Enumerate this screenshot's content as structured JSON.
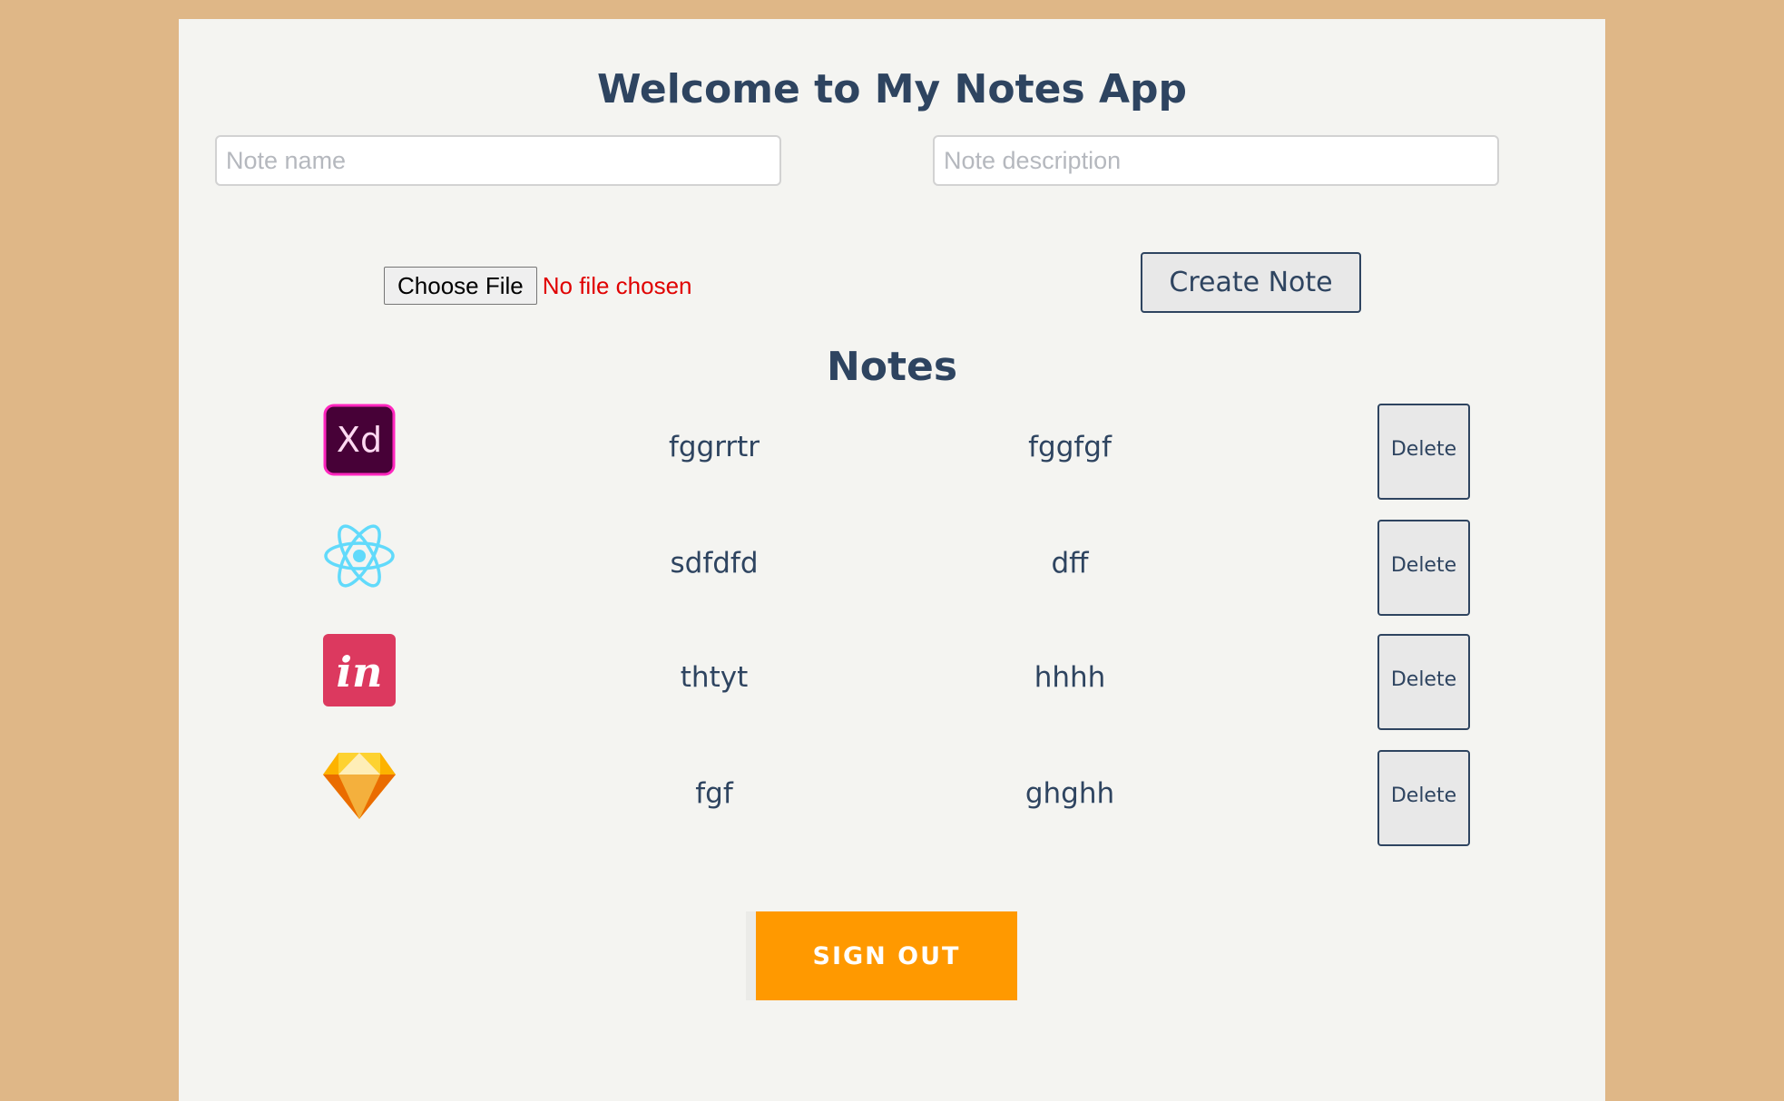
{
  "header": {
    "title": "Welcome to My Notes App"
  },
  "form": {
    "name_placeholder": "Note name",
    "description_placeholder": "Note description",
    "file_button_label": "Choose File",
    "file_status": "No file chosen",
    "create_label": "Create Note"
  },
  "notes_section": {
    "title": "Notes",
    "notes": [
      {
        "icon": "adobe-xd-icon",
        "name": "fggrrtr",
        "description": "fggfgf",
        "delete_label": "Delete"
      },
      {
        "icon": "react-icon",
        "name": "sdfdfd",
        "description": "dff",
        "delete_label": "Delete"
      },
      {
        "icon": "invision-icon",
        "name": "thtyt",
        "description": "hhhh",
        "delete_label": "Delete"
      },
      {
        "icon": "sketch-icon",
        "name": "fgf",
        "description": "ghghh",
        "delete_label": "Delete"
      }
    ]
  },
  "footer": {
    "signout_label": "SIGN OUT"
  },
  "colors": {
    "page_background": "#DFB787",
    "card_background": "#F4F4F1",
    "heading_text": "#2E4460",
    "signout_button": "#FF9900",
    "file_status_text": "#E00000"
  }
}
